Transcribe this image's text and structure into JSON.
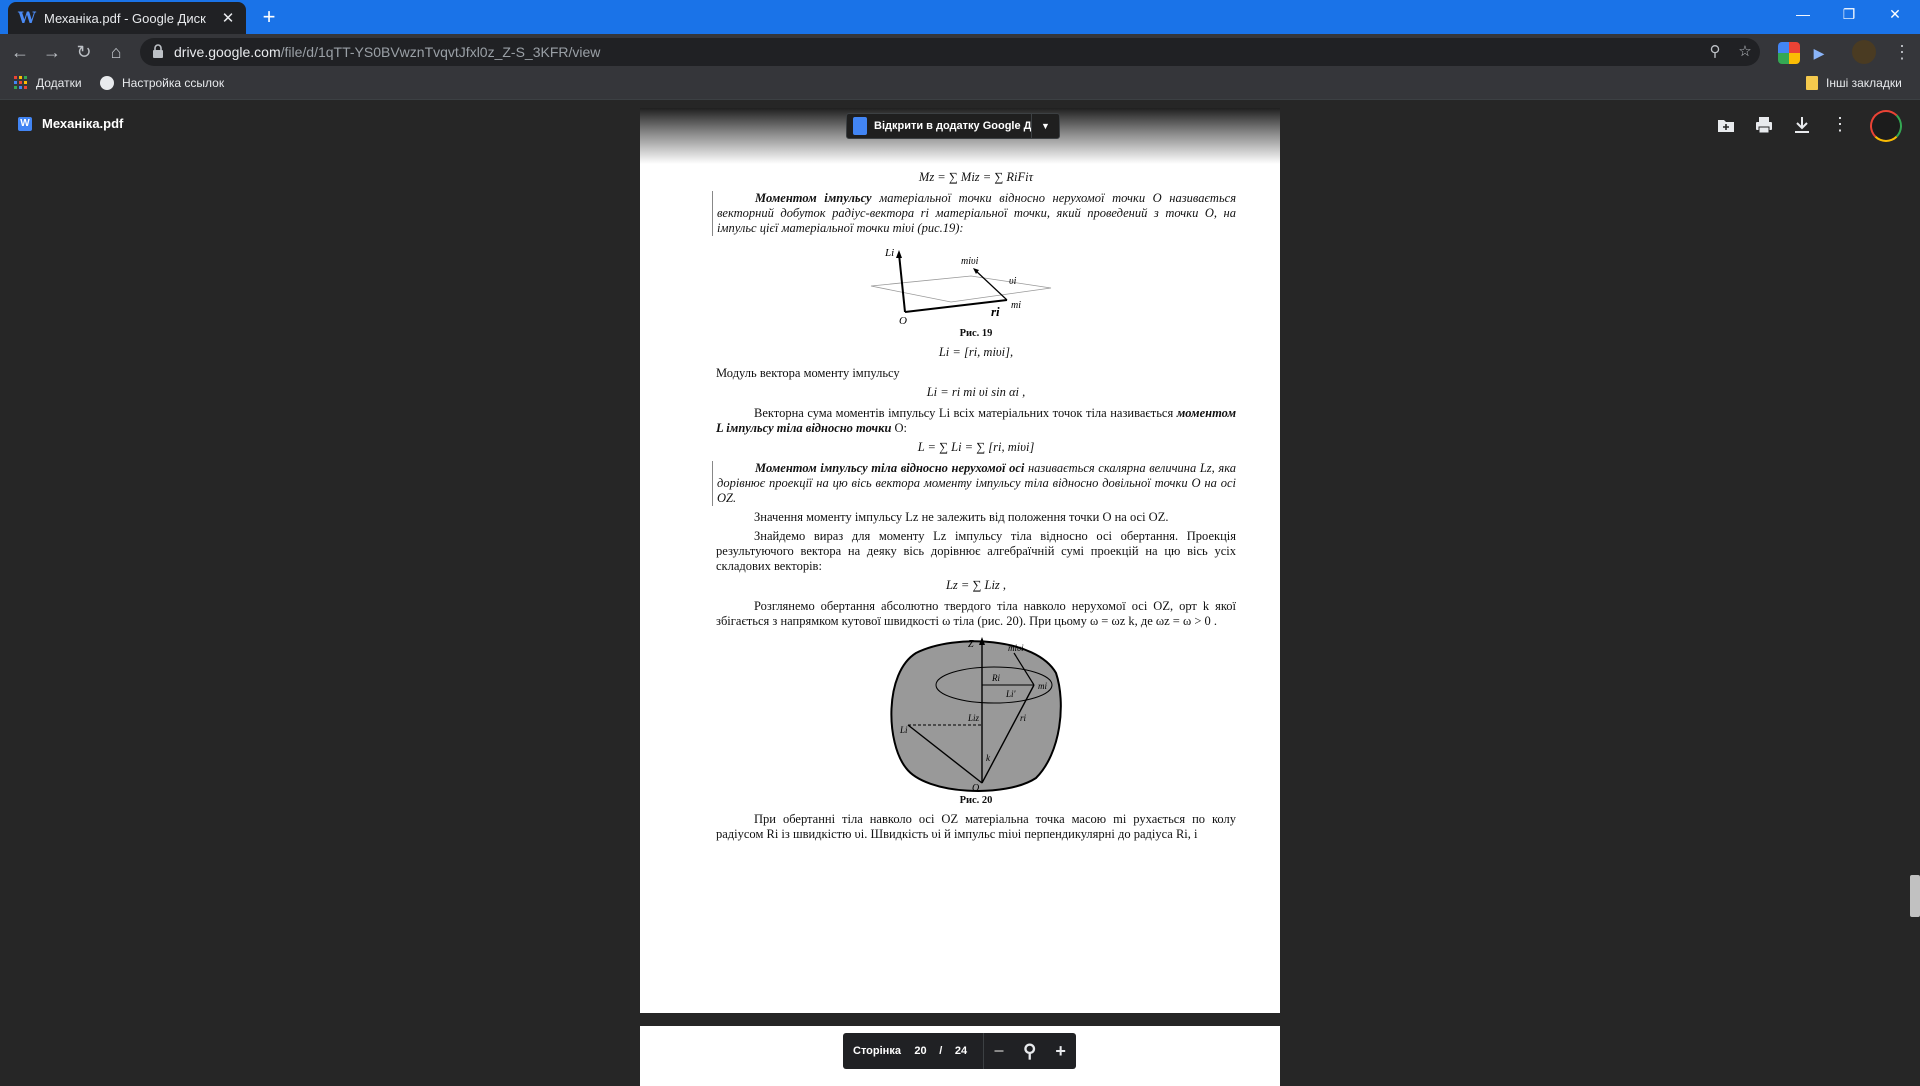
{
  "browser": {
    "tab_title": "Механіка.pdf - Google Диск",
    "tab_favicon": "W",
    "url_host": "drive.google.com",
    "url_path": "/file/d/1qTT-YS0BVwznTvqvtJfxl0z_Z-S_3KFR/view",
    "bookmarks": [
      {
        "label": "Додатки",
        "icon": "apps-grid-icon"
      },
      {
        "label": "Настройка ссылок",
        "icon": "globe-icon"
      }
    ],
    "other_bookmarks": "Інші закладки"
  },
  "viewer": {
    "file_name": "Механіка.pdf",
    "open_with_label": "Відкрити в додатку Google До...",
    "pager": {
      "label": "Сторінка",
      "current": "20",
      "separator": "/",
      "total": "24"
    }
  },
  "page": {
    "formula_mz": "Mz = ∑ Miz = ∑ RiFiτ",
    "p1_bold": "Моментом імпульсу",
    "p1_rest": "матеріальної точки відносно нерухомої точки O називається векторний добуток радіус-вектора ri матеріальної точки, який проведений з точки O, на імпульс цієї матеріальної точки miυi (рис.19):",
    "fig19_caption": "Рис. 19",
    "formula_li": "Li = [ri, miυi],",
    "p2": "Модуль вектора моменту імпульсу",
    "formula_li_mod": "Li = ri mi υi sin αi ,",
    "p3_start": "Векторна сума моментів імпульсу Li всіх матеріальних точок тіла називається",
    "p3_bold": "моментом L імпульсу тіла відносно точки",
    "p3_end": "O:",
    "formula_l": "L = ∑ Li = ∑ [ri, miυi]",
    "p4_bold": "Моментом імпульсу тіла відносно нерухомої осі",
    "p4_rest": "називається скалярна величина Lz, яка дорівнює проекції на цю вісь вектора моменту імпульсу тіла відносно довільної точки O на осі OZ.",
    "p5": "Значення моменту імпульсу Lz не залежить від положення точки O на осі OZ.",
    "p6": "Знайдемо вираз для моменту Lz імпульсу тіла відносно осі обертання. Проекція результуючого вектора на деяку вісь дорівнює алгебраїчній сумі проекцій на цю вісь усіх складових векторів:",
    "formula_lz": "Lz = ∑ Liz ,",
    "p7": "Розглянемо обертання абсолютно твердого тіла навколо нерухомої осі OZ, орт k якої збігається з напрямком кутової швидкості ω тіла (рис. 20). При цьому ω = ωz k, де ωz = ω > 0 .",
    "fig20_caption": "Рис. 20",
    "p8": "При обертанні тіла навколо осі OZ матеріальна точка масою mi рухається по колу радіусом Ri із швидкістю υi. Швидкість υi й імпульс miυi перпендикулярні до радіуса Ri, і"
  },
  "fig_labels": {
    "f19": {
      "L": "Li",
      "mv": "miυi",
      "v": "υi",
      "O": "O",
      "r": "ri",
      "m": "mi"
    },
    "f20": {
      "Z": "Z",
      "mv": "miυi",
      "R": "Ri",
      "m": "mi",
      "Liz": "Liz",
      "Li": "Li",
      "r": "ri",
      "k": "k",
      "O": "O",
      "Lprime": "Li'"
    }
  }
}
